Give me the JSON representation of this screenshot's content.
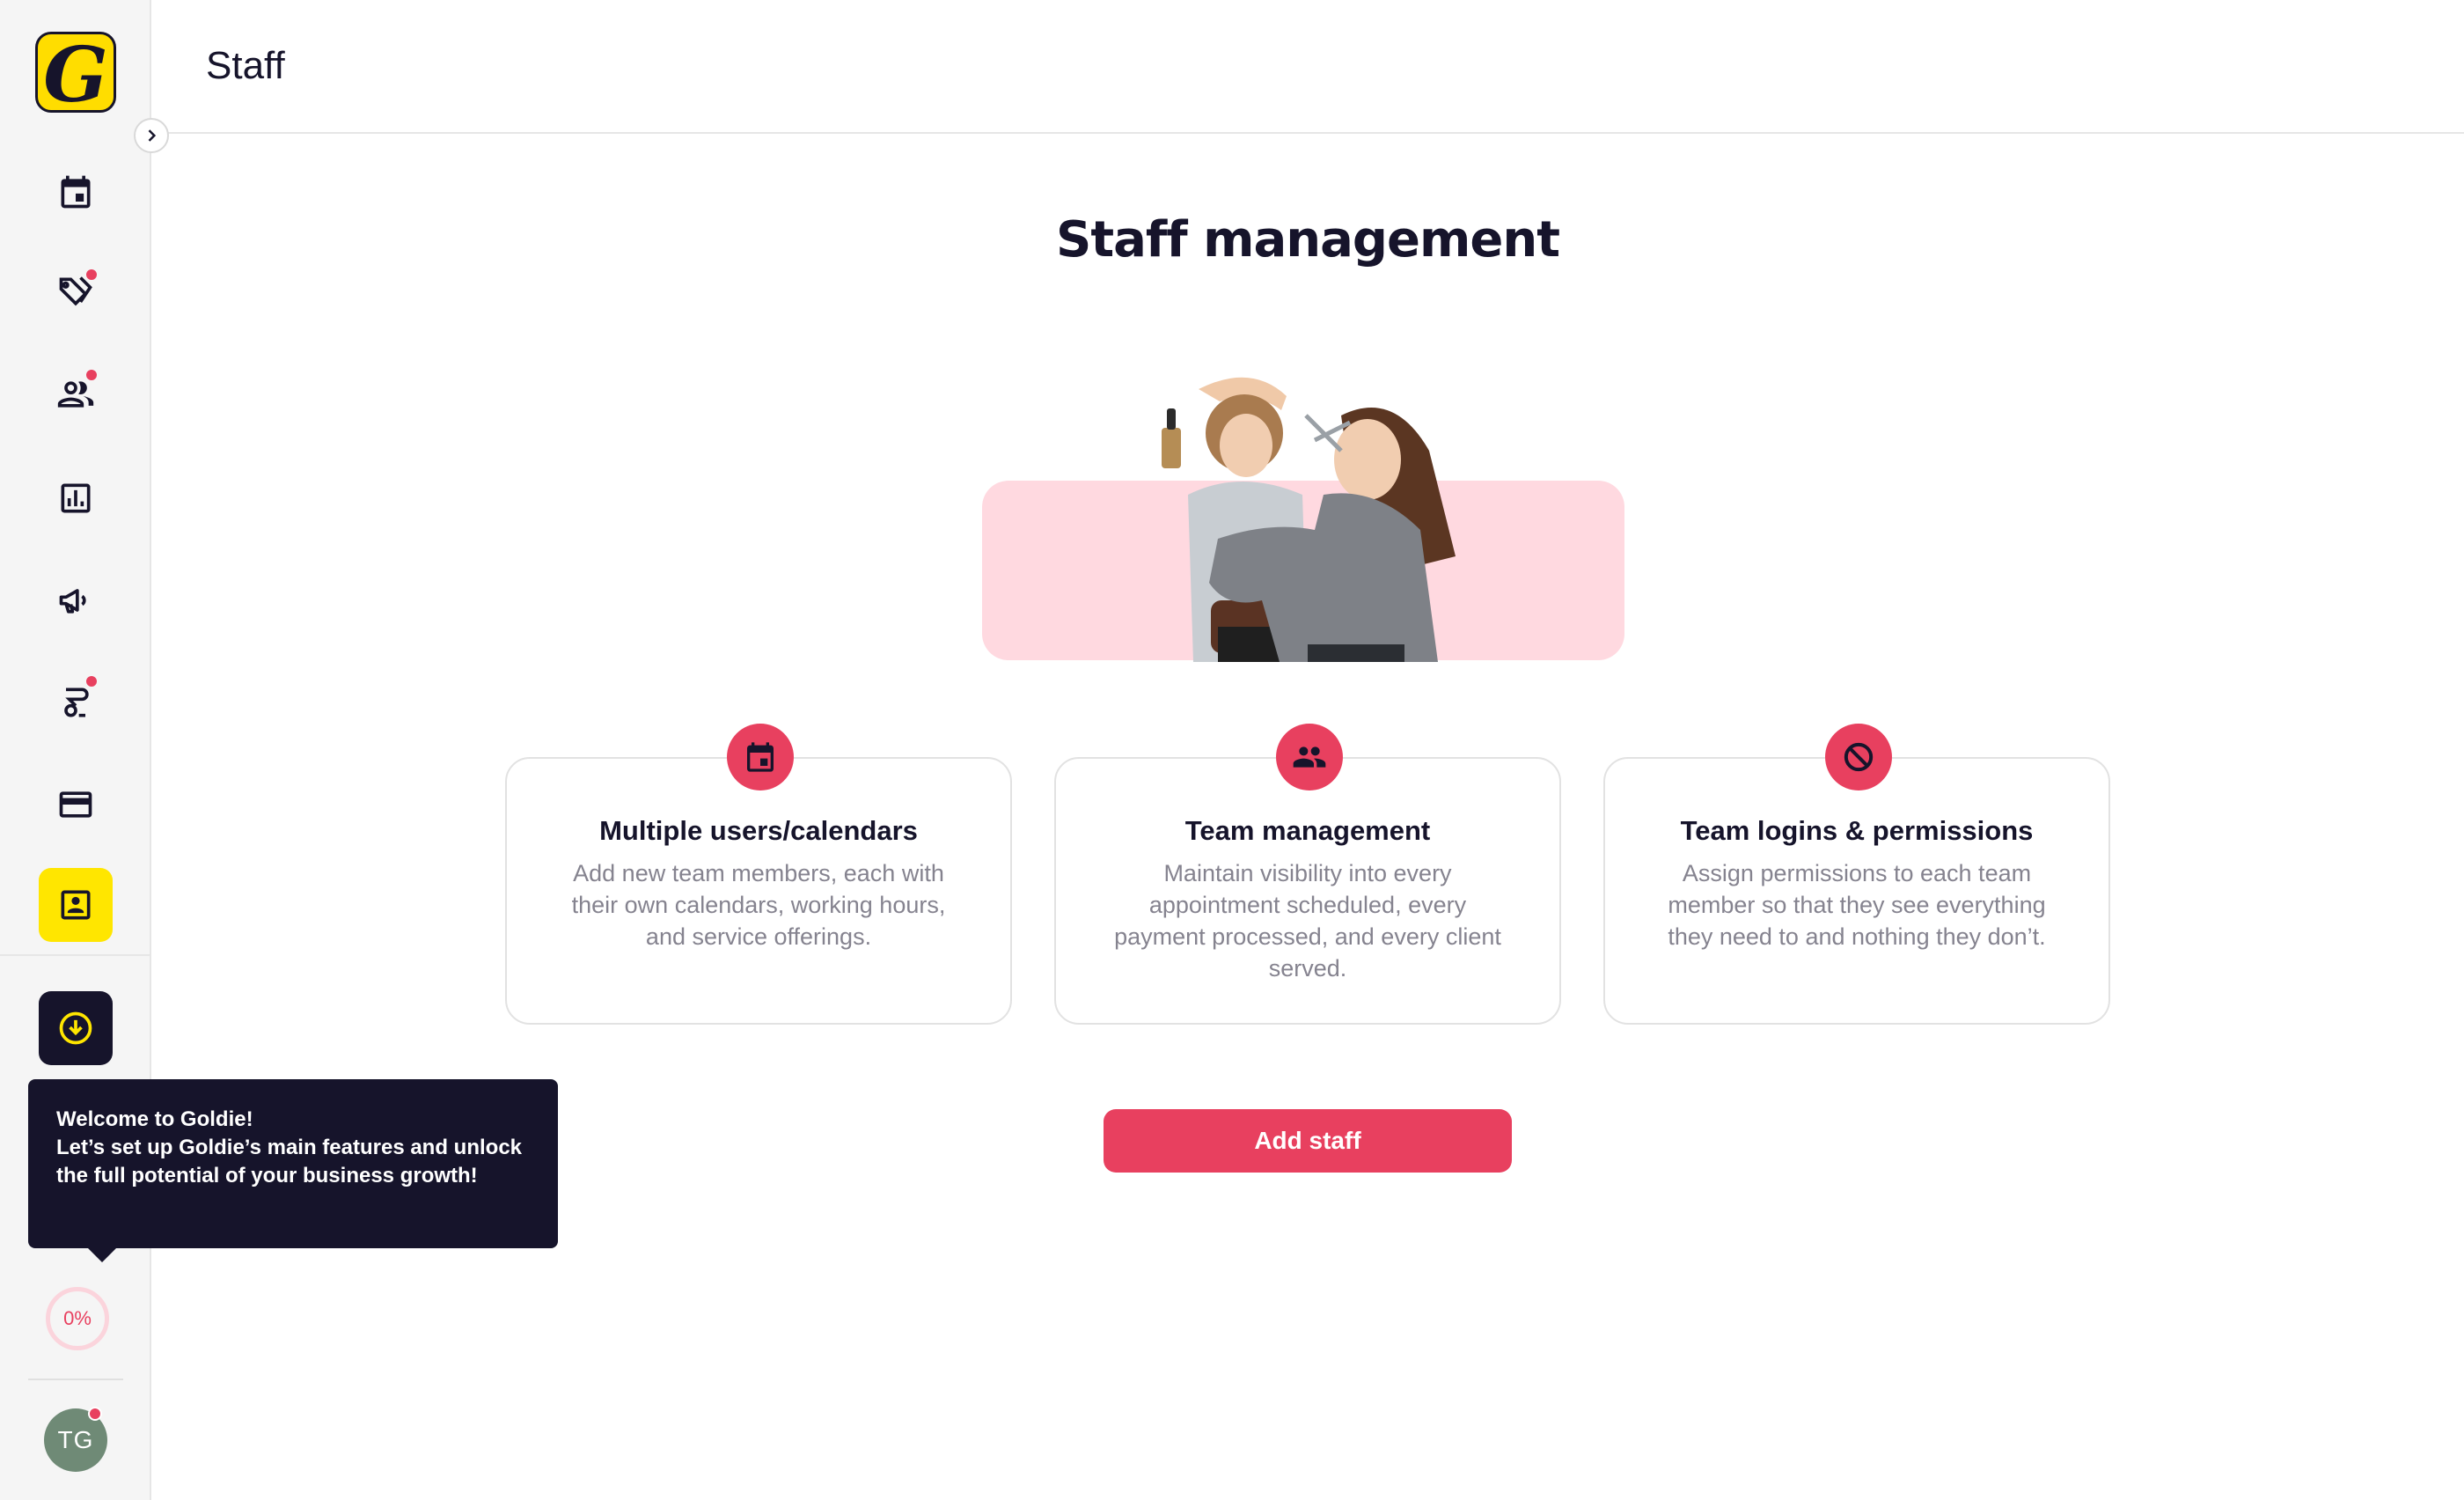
{
  "app": {
    "name": "Goldie",
    "logo_letter": "G"
  },
  "header": {
    "title": "Staff"
  },
  "sidebar": {
    "items": [
      {
        "name": "calendar",
        "icon": "calendar-icon",
        "badge": false,
        "active": false
      },
      {
        "name": "services",
        "icon": "tag-icon",
        "badge": true,
        "active": false
      },
      {
        "name": "clients",
        "icon": "people-icon",
        "badge": true,
        "active": false
      },
      {
        "name": "reports",
        "icon": "bar-chart-icon",
        "badge": false,
        "active": false
      },
      {
        "name": "marketing",
        "icon": "megaphone-icon",
        "badge": false,
        "active": false
      },
      {
        "name": "setup",
        "icon": "scissors-icon",
        "badge": true,
        "active": false
      },
      {
        "name": "payments",
        "icon": "credit-card-icon",
        "badge": false,
        "active": false
      },
      {
        "name": "staff",
        "icon": "contact-card-icon",
        "badge": false,
        "active": true
      }
    ],
    "progress": "0%",
    "user_initials": "TG"
  },
  "tooltip": {
    "title": "Welcome to Goldie!",
    "body": "Let’s set up Goldie’s main features and unlock the full potential of your business growth!"
  },
  "main": {
    "title": "Staff management",
    "features": [
      {
        "icon": "calendar-icon",
        "title": "Multiple users/calendars",
        "description": "Add new team members, each with their own calendars, working hours, and service offerings."
      },
      {
        "icon": "group-icon",
        "title": "Team management",
        "description": "Maintain visibility into every appointment scheduled, every payment processed, and every client served."
      },
      {
        "icon": "block-icon",
        "title": "Team logins & permissions",
        "description": "Assign permissions to each team member so that they see everything they need to and nothing they don’t."
      }
    ],
    "cta_label": "Add staff"
  },
  "colors": {
    "accent": "#e8405f",
    "brand_yellow": "#ffe600",
    "dark": "#16142b",
    "hero_pink": "#ffd9e0"
  }
}
